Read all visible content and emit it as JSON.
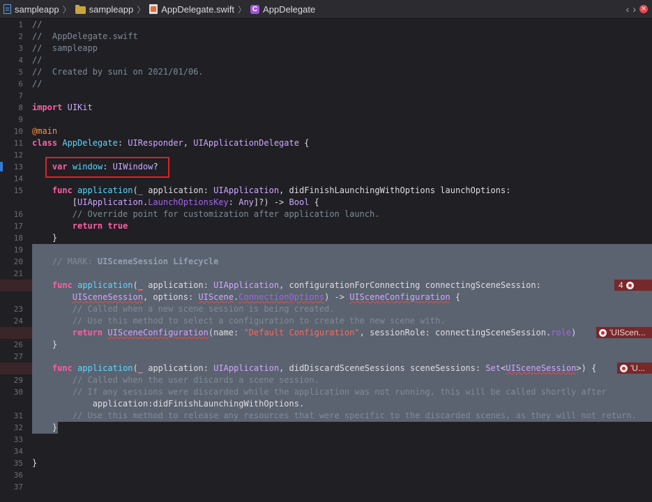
{
  "jumpbar": {
    "crumbs": [
      {
        "label": "sampleapp",
        "icon": "project-file-icon"
      },
      {
        "label": "sampleapp",
        "icon": "folder-icon"
      },
      {
        "label": "AppDelegate.swift",
        "icon": "swift-file-icon"
      },
      {
        "label": "AppDelegate",
        "icon": "class-c-icon"
      }
    ],
    "class_glyph": "C",
    "back": "‹",
    "forward": "›",
    "issue_glyph": "×"
  },
  "gutter": {
    "line_numbers": [
      "1",
      "2",
      "3",
      "4",
      "5",
      "6",
      "7",
      "8",
      "9",
      "10",
      "11",
      "12",
      "13",
      "14",
      "15",
      "16",
      "17",
      "18",
      "19",
      "20",
      "21",
      "22",
      "23",
      "24",
      "25",
      "26",
      "27",
      "28",
      "29",
      "30",
      "31",
      "32",
      "33",
      "34",
      "35",
      "36",
      "37"
    ]
  },
  "code": {
    "lines": [
      "//",
      "//  AppDelegate.swift",
      "//  sampleapp",
      "//",
      "//  Created by suni on 2021/01/06.",
      "//",
      "",
      "import UIKit",
      "",
      "@main",
      "class AppDelegate: UIResponder, UIApplicationDelegate {",
      "",
      "    var window: UIWindow?",
      "",
      "    func application(_ application: UIApplication, didFinishLaunchingWithOptions launchOptions:",
      "        [UIApplication.LaunchOptionsKey: Any]?) -> Bool {",
      "        // Override point for customization after application launch.",
      "        return true",
      "    }",
      "",
      "    // MARK: UISceneSession Lifecycle",
      "",
      "    func application(_ application: UIApplication, configurationForConnecting connectingSceneSession:",
      "        UISceneSession, options: UIScene.ConnectionOptions) -> UISceneConfiguration {",
      "        // Called when a new scene session is being created.",
      "        // Use this method to select a configuration to create the new scene with.",
      "        return UISceneConfiguration(name: \"Default Configuration\", sessionRole: connectingSceneSession.role)",
      "    }",
      "",
      "    func application(_ application: UIApplication, didDiscardSceneSessions sceneSessions: Set<UISceneSession>) {",
      "        // Called when the user discards a scene session.",
      "        // If any sessions were discarded while the application was not running, this will be called shortly after",
      "            application:didFinishLaunchingWithOptions.",
      "        // Use this method to release any resources that were specific to the discarded scenes, as they will not return.",
      "    }",
      "",
      "",
      "}"
    ]
  },
  "errors": [
    {
      "line": "22",
      "count": "4"
    },
    {
      "line": "25",
      "text": "'UIScen..."
    },
    {
      "line": "28",
      "text": "'U..."
    }
  ],
  "colors": {
    "background": "#1f1f24",
    "keyword": "#fc5fa3",
    "comment": "#7f8c98",
    "type": "#d0a8ff",
    "declaration": "#5dd8ff",
    "string": "#fc6a5d",
    "selection": "#5b6270",
    "error": "#76282b",
    "highlight_box": "#e51f1f"
  }
}
